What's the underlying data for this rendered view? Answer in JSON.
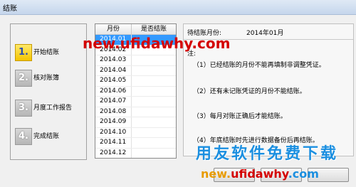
{
  "window": {
    "title": "结账"
  },
  "steps": [
    {
      "number": "1.",
      "label": "开始结账",
      "active": true
    },
    {
      "number": "2.",
      "label": "核对账簿",
      "active": false
    },
    {
      "number": "3.",
      "label": "月度工作报告",
      "active": false
    },
    {
      "number": "4.",
      "label": "完成结账",
      "active": false
    }
  ],
  "list": {
    "headers": {
      "month": "月份",
      "status": "是否结账"
    },
    "rows": [
      {
        "month": "2014.01",
        "status": ""
      },
      {
        "month": "2014.02",
        "status": ""
      },
      {
        "month": "2014.03",
        "status": ""
      },
      {
        "month": "2014.04",
        "status": ""
      },
      {
        "month": "2014.05",
        "status": ""
      },
      {
        "month": "2014.06",
        "status": ""
      },
      {
        "month": "2014.07",
        "status": ""
      },
      {
        "month": "2014.08",
        "status": ""
      },
      {
        "month": "2014.09",
        "status": ""
      },
      {
        "month": "2014.10",
        "status": ""
      },
      {
        "month": "2014.11",
        "status": ""
      },
      {
        "month": "2014.12",
        "status": ""
      }
    ],
    "selected_index": 0
  },
  "report": {
    "pending_label": "待结账月份:",
    "pending_value": "2014年01月",
    "note_label": "注:",
    "notes": [
      "（1）已经结账的月份不能再填制非调整凭证。",
      "（2）还有未记账凭证的月份不能结账。",
      "（3）每月对账正确后才能结账。",
      "（4）年底结账时先进行数据备份后再结账。"
    ]
  },
  "watermark": {
    "top_url": "new.ufidawhy.com",
    "cn_text": "用友软件免费下载",
    "bottom_url_a": "new.",
    "bottom_url_b": "ufidawhy",
    "bottom_url_c": ".com"
  },
  "colors": {
    "selection": "#3399ff",
    "active_badge": "#f4c400",
    "watermark_red": "#d40000",
    "watermark_blue": "#1b8fe0"
  }
}
